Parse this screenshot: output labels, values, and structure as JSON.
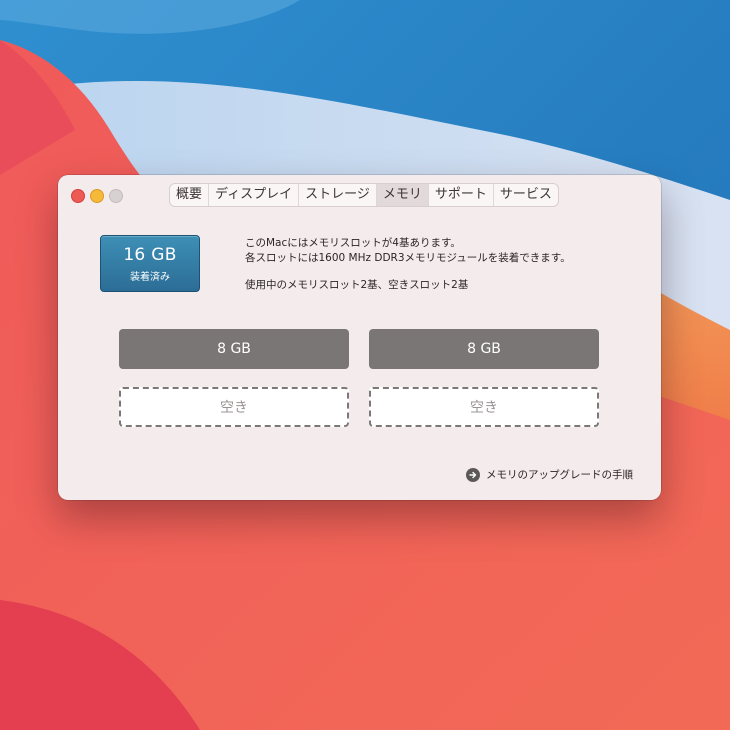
{
  "window": {
    "tabs": [
      {
        "label": "概要"
      },
      {
        "label": "ディスプレイ"
      },
      {
        "label": "ストレージ"
      },
      {
        "label": "メモリ"
      },
      {
        "label": "サポート"
      },
      {
        "label": "サービス"
      }
    ],
    "active_tab": "メモリ"
  },
  "memory": {
    "total": "16 GB",
    "installed_label": "装着済み",
    "info_line1": "このMacにはメモリスロットが4基あります。",
    "info_line2": "各スロットには1600 MHz DDR3メモリモジュールを装着できます。",
    "info_line3": "使用中のメモリスロット2基、空きスロット2基",
    "slots": [
      {
        "label": "8 GB",
        "state": "filled"
      },
      {
        "label": "8 GB",
        "state": "filled"
      },
      {
        "label": "空き",
        "state": "empty"
      },
      {
        "label": "空き",
        "state": "empty"
      }
    ],
    "upgrade_link": "メモリのアップグレードの手順"
  },
  "colors": {
    "badge": "#2f77a0",
    "slot_filled": "#7b7676",
    "traffic_close": "#ee5b55",
    "traffic_minimize": "#f6b93a"
  },
  "icons": {
    "upgrade_link": "arrow-right-circle-icon"
  }
}
